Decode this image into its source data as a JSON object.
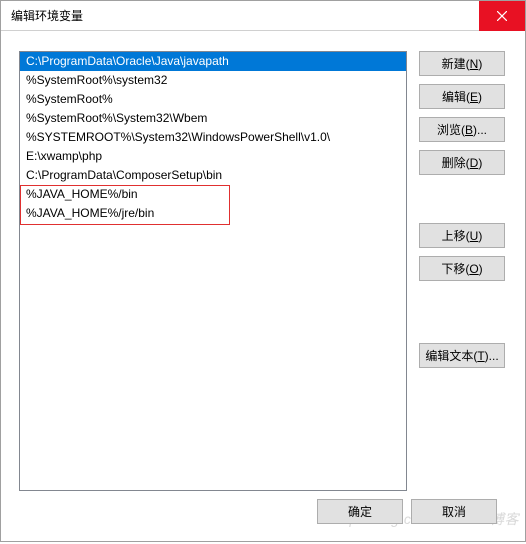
{
  "title": "编辑环境变量",
  "list": [
    "C:\\ProgramData\\Oracle\\Java\\javapath",
    "%SystemRoot%\\system32",
    "%SystemRoot%",
    "%SystemRoot%\\System32\\Wbem",
    "%SYSTEMROOT%\\System32\\WindowsPowerShell\\v1.0\\",
    "E:\\xwamp\\php",
    "C:\\ProgramData\\ComposerSetup\\bin",
    "%JAVA_HOME%/bin",
    "%JAVA_HOME%/jre/bin"
  ],
  "selected_index": 0,
  "buttons": {
    "new_label": "新建(",
    "new_key": "N",
    "edit_label": "编辑(",
    "edit_key": "E",
    "browse_label": "浏览(",
    "browse_key": "B",
    "delete_label": "删除(",
    "delete_key": "D",
    "up_label": "上移(",
    "up_key": "U",
    "down_label": "下移(",
    "down_key": "O",
    "editText_label": "编辑文本(",
    "editText_key": "T",
    "close_paren": ")",
    "close_paren_dots": ")...",
    "ok": "确定",
    "cancel": "取消"
  },
  "watermark": "http://blog.csdn.net/510博客"
}
